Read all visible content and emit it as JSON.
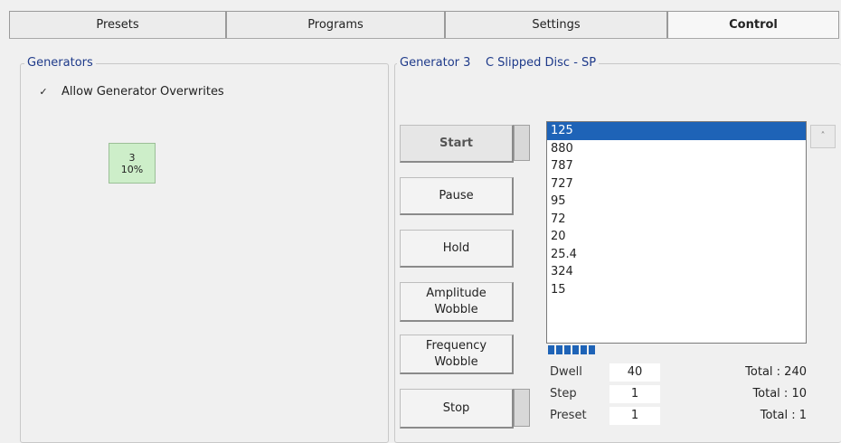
{
  "tabs": [
    {
      "label": "Presets",
      "active": false
    },
    {
      "label": "Programs",
      "active": false
    },
    {
      "label": "Settings",
      "active": false
    },
    {
      "label": "Control",
      "active": true
    }
  ],
  "generators_panel": {
    "title": "Generators",
    "checkbox_label": "Allow Generator Overwrites",
    "checkbox_checked": true,
    "generator_tile": {
      "number": "3",
      "percent": "10%"
    }
  },
  "generator_panel": {
    "title": "Generator 3",
    "program_name": "C Slipped Disc - SP"
  },
  "controls": {
    "start": "Start",
    "pause": "Pause",
    "hold": "Hold",
    "amplitude_wobble": [
      "Amplitude",
      "Wobble"
    ],
    "frequency_wobble": [
      "Frequency",
      "Wobble"
    ],
    "stop": "Stop"
  },
  "frequencies": [
    "125",
    "880",
    "787",
    "727",
    "95",
    "72",
    "20",
    "25.4",
    "324",
    "15"
  ],
  "selected_index": 0,
  "progress_segments": 6,
  "stats": {
    "dwell_label": "Dwell",
    "dwell_value": "40",
    "dwell_total": "Total : 240",
    "step_label": "Step",
    "step_value": "1",
    "step_total": "Total : 10",
    "preset_label": "Preset",
    "preset_value": "1",
    "preset_total": "Total : 1"
  },
  "colors": {
    "accent": "#1e63b7",
    "tile": "#cdeec9",
    "legend": "#1e3a8a"
  }
}
